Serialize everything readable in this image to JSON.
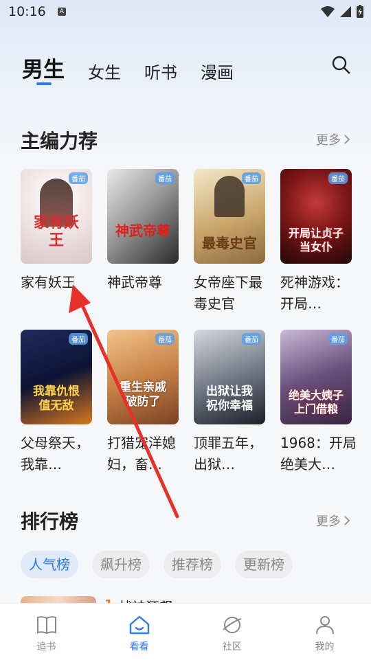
{
  "status": {
    "time": "10:16",
    "badge": "A"
  },
  "tabs": [
    {
      "label": "男生",
      "active": true
    },
    {
      "label": "女生",
      "active": false
    },
    {
      "label": "听书",
      "active": false
    },
    {
      "label": "漫画",
      "active": false
    }
  ],
  "recommend": {
    "title": "主编力荐",
    "more": "更多",
    "books": [
      {
        "title": "家有妖王",
        "cover_text": "家有妖王",
        "tag": "番茄"
      },
      {
        "title": "神武帝尊",
        "cover_text": "神武帝尊",
        "tag": "番茄"
      },
      {
        "title": "女帝座下最毒史官",
        "cover_text": "最毒史官",
        "tag": "番茄"
      },
      {
        "title": "死神游戏：开局…",
        "cover_text": "开局让贞子当女仆",
        "tag": "番茄"
      },
      {
        "title": "父母祭天，我靠…",
        "cover_text": "我靠仇恨值无敌",
        "tag": "番茄"
      },
      {
        "title": "打猎宠洋媳妇，畜…",
        "cover_text": "重生亲戚破防了",
        "tag": "番茄"
      },
      {
        "title": "顶罪五年，出狱…",
        "cover_text": "出狱让我祝你幸福",
        "tag": "番茄"
      },
      {
        "title": "1968：开局绝美大…",
        "cover_text": "绝美大姨子上门借粮",
        "tag": "番茄"
      }
    ]
  },
  "ranking": {
    "title": "排行榜",
    "more": "更多",
    "chips": [
      {
        "label": "人气榜",
        "active": true
      },
      {
        "label": "飙升榜",
        "active": false
      },
      {
        "label": "推荐榜",
        "active": false
      },
      {
        "label": "更新榜",
        "active": false
      }
    ],
    "first": {
      "rank": "1",
      "name": "战神狂飙"
    }
  },
  "nav": [
    {
      "label": "追书",
      "icon": "book-icon",
      "active": false
    },
    {
      "label": "看看",
      "icon": "home-icon",
      "active": true
    },
    {
      "label": "社区",
      "icon": "planet-icon",
      "active": false
    },
    {
      "label": "我的",
      "icon": "user-icon",
      "active": false
    }
  ],
  "annotation_color": "#e8302a",
  "accent_color": "#2d7be6"
}
